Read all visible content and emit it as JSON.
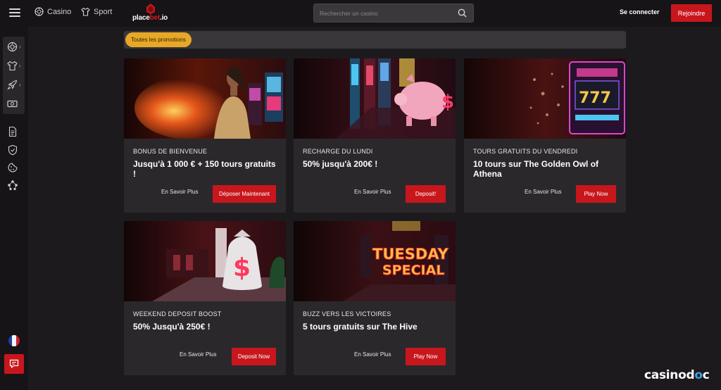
{
  "header": {
    "nav": [
      {
        "label": "Casino",
        "icon": "casino-chip-icon"
      },
      {
        "label": "Sport",
        "icon": "jersey-icon"
      }
    ],
    "logo": {
      "part1": "place",
      "part2": "bet",
      "part3": ".io"
    },
    "search": {
      "placeholder": "Rechercher un casino"
    },
    "login_label": "Se connecter",
    "join_label": "Rejoindre"
  },
  "sidebar": {
    "group": [
      "casino-chip-icon",
      "jersey-icon",
      "rocket-icon",
      "cash-icon"
    ],
    "items": [
      "document-icon",
      "shield-icon",
      "cookie-icon",
      "network-icon"
    ],
    "flag": "french-flag-icon",
    "chat": "chat-icon"
  },
  "filter": {
    "active_label": "Toutes les promotions"
  },
  "promos": [
    {
      "category": "BONUS DE BIENVENUE",
      "title": "Jusqu'à 1 000 € + 150 tours gratuits !",
      "more": "En Savoir Plus",
      "cta": "Déposer Maintenant"
    },
    {
      "category": "RECHARGE DU LUNDI",
      "title": "50% jusqu'à 200€ !",
      "more": "En Savoir Plus",
      "cta": "Deposit!"
    },
    {
      "category": "TOURS GRATUITS DU VENDREDI",
      "title": "10 tours sur The Golden Owl of Athena",
      "more": "En Savoir Plus",
      "cta": "Play Now"
    },
    {
      "category": "WEEKEND DEPOSIT BOOST",
      "title": "50% Jusqu'à 250€ !",
      "more": "En Savoir Plus",
      "cta": "Deposit Now"
    },
    {
      "category": "BUZZ VERS LES VICTOIRES",
      "title": "5 tours gratuits sur The Hive",
      "more": "En Savoir Plus",
      "cta": "Play Now"
    }
  ],
  "images": {
    "slot_reels": "777",
    "tuesday_line1": "TUESDAY",
    "tuesday_line2": "SPECIAL",
    "money_symbol": "$"
  },
  "watermark": {
    "part1": "casinod",
    "part2": "o",
    "part3": "c"
  },
  "colors": {
    "accent": "#c8161d",
    "pill": "#e8a827",
    "background": "#1c1a1d",
    "card": "#2b282c"
  }
}
